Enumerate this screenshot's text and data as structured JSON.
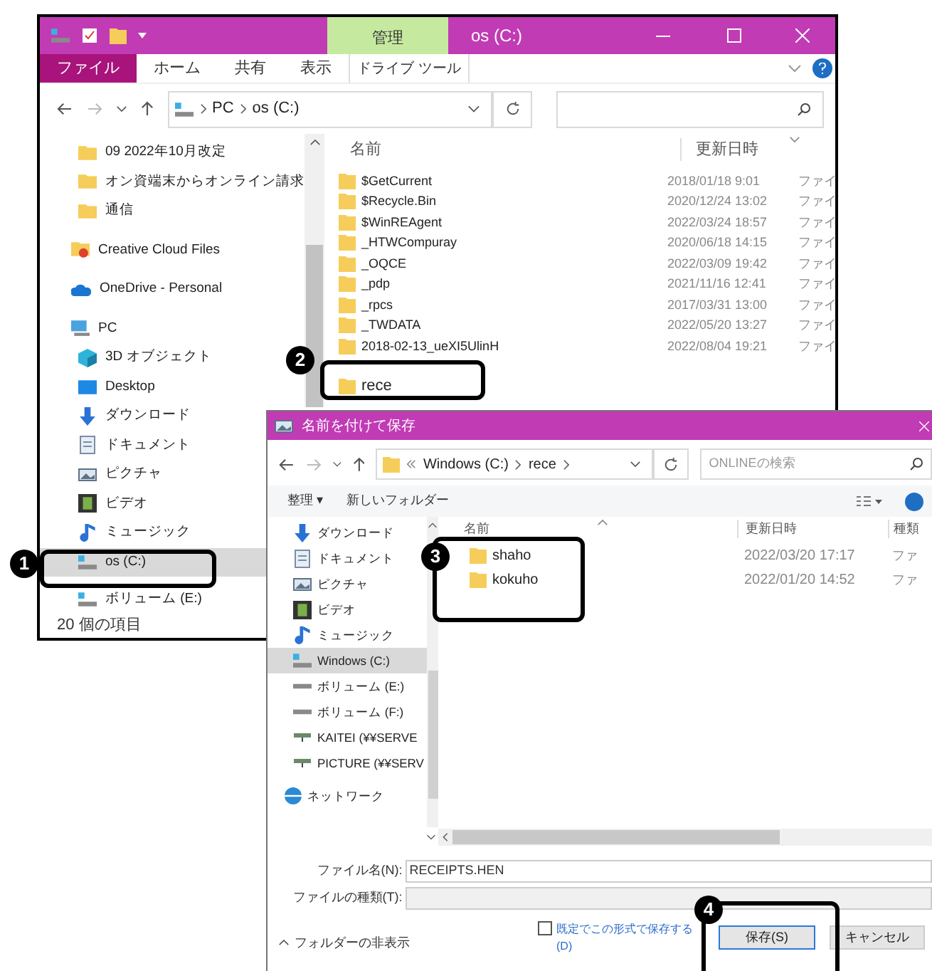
{
  "explorer": {
    "title": "os (C:)",
    "context_tab": "管理",
    "ribbon_tabs": [
      {
        "label": "ファイル",
        "kind": "file"
      },
      {
        "label": "ホーム",
        "kind": "tab"
      },
      {
        "label": "共有",
        "kind": "tab"
      },
      {
        "label": "表示",
        "kind": "tab"
      },
      {
        "label": "ドライブ ツール",
        "kind": "context"
      }
    ],
    "address": [
      "PC",
      "os (C:)"
    ],
    "nav": [
      {
        "label": "09 2022年10月改定",
        "kind": "folder",
        "selected": false
      },
      {
        "label": "オン資端末からオンライン請求",
        "kind": "folder",
        "selected": false
      },
      {
        "label": "通信",
        "kind": "folder",
        "selected": false
      },
      {
        "label": "Creative Cloud Files",
        "kind": "cloud-folder",
        "selected": false
      },
      {
        "label": "OneDrive - Personal",
        "kind": "cloud",
        "selected": false
      },
      {
        "label": "PC",
        "kind": "pc",
        "selected": false
      },
      {
        "label": "3D オブジェクト",
        "kind": "cube",
        "selected": false
      },
      {
        "label": "Desktop",
        "kind": "desktop",
        "selected": false
      },
      {
        "label": "ダウンロード",
        "kind": "download",
        "selected": false
      },
      {
        "label": "ドキュメント",
        "kind": "document",
        "selected": false
      },
      {
        "label": "ピクチャ",
        "kind": "picture",
        "selected": false
      },
      {
        "label": "ビデオ",
        "kind": "video",
        "selected": false
      },
      {
        "label": "ミュージック",
        "kind": "music",
        "selected": false
      },
      {
        "label": "os (C:)",
        "kind": "drive",
        "selected": true
      },
      {
        "label": "ボリューム (E:)",
        "kind": "drive",
        "selected": false
      }
    ],
    "columns": [
      "名前",
      "更新日時"
    ],
    "rows": [
      {
        "name": "$GetCurrent",
        "date": "2018/01/18 9:01",
        "type": "ファイ"
      },
      {
        "name": "$Recycle.Bin",
        "date": "2020/12/24 13:02",
        "type": "ファイ"
      },
      {
        "name": "$WinREAgent",
        "date": "2022/03/24 18:57",
        "type": "ファイ"
      },
      {
        "name": "_HTWCompuray",
        "date": "2020/06/18 14:15",
        "type": "ファイ"
      },
      {
        "name": "_OQCE",
        "date": "2022/03/09 19:42",
        "type": "ファイ"
      },
      {
        "name": "_pdp",
        "date": "2021/11/16 12:41",
        "type": "ファイ"
      },
      {
        "name": "_rpcs",
        "date": "2017/03/31 13:00",
        "type": "ファイ"
      },
      {
        "name": "_TWDATA",
        "date": "2022/05/20 13:27",
        "type": "ファイ"
      },
      {
        "name": "2018-02-13_ueXI5UlinH",
        "date": "2022/08/04 19:21",
        "type": "ファイ"
      },
      {
        "name": "rece",
        "date": "",
        "type": ""
      }
    ],
    "status": "20 個の項目"
  },
  "dialog": {
    "title": "名前を付けて保存",
    "address": [
      "Windows (C:)",
      "rece"
    ],
    "search_placeholder": "ONLINEの検索",
    "toolbar": [
      "整理 ▾",
      "新しいフォルダー"
    ],
    "nav": [
      {
        "label": "ダウンロード",
        "kind": "download",
        "selected": false
      },
      {
        "label": "ドキュメント",
        "kind": "document",
        "selected": false
      },
      {
        "label": "ピクチャ",
        "kind": "picture",
        "selected": false
      },
      {
        "label": "ビデオ",
        "kind": "video",
        "selected": false
      },
      {
        "label": "ミュージック",
        "kind": "music",
        "selected": false
      },
      {
        "label": "Windows (C:)",
        "kind": "drive",
        "selected": true
      },
      {
        "label": "ボリューム (E:)",
        "kind": "disk",
        "selected": false
      },
      {
        "label": "ボリューム (F:)",
        "kind": "disk",
        "selected": false
      },
      {
        "label": "KAITEI (¥¥SERVE",
        "kind": "netdrive",
        "selected": false
      },
      {
        "label": "PICTURE (¥¥SERV",
        "kind": "netdrive",
        "selected": false
      },
      {
        "label": "ネットワーク",
        "kind": "network",
        "selected": false
      }
    ],
    "columns": [
      "名前",
      "更新日時",
      "種類"
    ],
    "rows": [
      {
        "name": "shaho",
        "date": "2022/03/20 17:17",
        "type": "ファ"
      },
      {
        "name": "kokuho",
        "date": "2022/01/20 14:52",
        "type": "ファ"
      }
    ],
    "filename_label": "ファイル名(N):",
    "filename": "RECEIPTS.HEN",
    "filetype_label": "ファイルの種類(T):",
    "hide_folders": "フォルダーの非表示",
    "default_format": {
      "label": "既定でこの形式で保存する(D)",
      "checked": false
    },
    "buttons": [
      "保存(S)",
      "キャンセル"
    ]
  },
  "callouts": [
    {
      "number": "1"
    },
    {
      "number": "2"
    },
    {
      "number": "3"
    },
    {
      "number": "4"
    }
  ]
}
